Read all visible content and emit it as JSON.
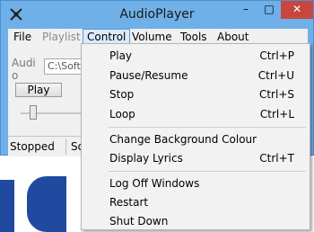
{
  "window": {
    "title": "AudioPlayer",
    "controls": {
      "minimize": "–",
      "maximize": "□",
      "close": "✕"
    }
  },
  "menubar": {
    "items": [
      {
        "label": "File",
        "state": "normal"
      },
      {
        "label": "Playlist",
        "state": "disabled"
      },
      {
        "label": "Control",
        "state": "active"
      },
      {
        "label": "Volume",
        "state": "normal"
      },
      {
        "label": "Tools",
        "state": "normal"
      },
      {
        "label": "About",
        "state": "normal"
      }
    ]
  },
  "client": {
    "audio_label": "Audio",
    "path_value": "C:\\Soft",
    "play_label": "Play"
  },
  "statusbar": {
    "status": "Stopped",
    "right_text": "So"
  },
  "control_menu": {
    "items": [
      {
        "label": "Play",
        "shortcut": "Ctrl+P"
      },
      {
        "label": "Pause/Resume",
        "shortcut": "Ctrl+U"
      },
      {
        "label": "Stop",
        "shortcut": "Ctrl+S"
      },
      {
        "label": "Loop",
        "shortcut": "Ctrl+L"
      },
      {
        "label": "Change Background Colour",
        "shortcut": ""
      },
      {
        "label": "Display Lyrics",
        "shortcut": "Ctrl+T"
      },
      {
        "label": "Log Off Windows",
        "shortcut": ""
      },
      {
        "label": "Restart",
        "shortcut": ""
      },
      {
        "label": "Shut Down",
        "shortcut": ""
      }
    ]
  },
  "colors": {
    "window_frame": "#6fb0e8",
    "close_button": "#c7463d",
    "background_logo": "#1f4aa0",
    "menu_highlight": "#dcebfb"
  }
}
